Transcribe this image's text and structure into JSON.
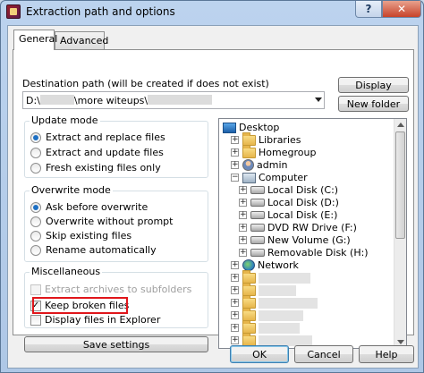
{
  "window": {
    "title": "Extraction path and options",
    "help_label": "?",
    "close_label": "✕"
  },
  "tabs": [
    {
      "label": "General",
      "active": true
    },
    {
      "label": "Advanced",
      "active": false
    }
  ],
  "destination": {
    "label": "Destination path (will be created if does not exist)",
    "path_prefix": "D:\\",
    "path_middle": "\\more witeups\\"
  },
  "buttons": {
    "display": "Display",
    "new_folder": "New folder",
    "save_settings": "Save settings",
    "ok": "OK",
    "cancel": "Cancel",
    "help": "Help"
  },
  "update_mode": {
    "title": "Update mode",
    "options": [
      {
        "label": "Extract and replace files",
        "selected": true
      },
      {
        "label": "Extract and update files",
        "selected": false
      },
      {
        "label": "Fresh existing files only",
        "selected": false
      }
    ]
  },
  "overwrite_mode": {
    "title": "Overwrite mode",
    "options": [
      {
        "label": "Ask before overwrite",
        "selected": true
      },
      {
        "label": "Overwrite without prompt",
        "selected": false
      },
      {
        "label": "Skip existing files",
        "selected": false
      },
      {
        "label": "Rename automatically",
        "selected": false
      }
    ]
  },
  "miscellaneous": {
    "title": "Miscellaneous",
    "options": [
      {
        "label": "Extract archives to subfolders",
        "checked": false,
        "disabled": true
      },
      {
        "label": "Keep broken files",
        "checked": true,
        "disabled": false
      },
      {
        "label": "Display files in Explorer",
        "checked": false,
        "disabled": false
      }
    ]
  },
  "tree": {
    "items": [
      {
        "label": "Desktop",
        "icon": "desktop-icon",
        "level": 0,
        "expander": ""
      },
      {
        "label": "Libraries",
        "icon": "folder-icon",
        "level": 1,
        "expander": "+"
      },
      {
        "label": "Homegroup",
        "icon": "folder-icon",
        "level": 1,
        "expander": "+"
      },
      {
        "label": "admin",
        "icon": "user-icon",
        "level": 1,
        "expander": "+"
      },
      {
        "label": "Computer",
        "icon": "computer-icon",
        "level": 1,
        "expander": "−"
      },
      {
        "label": "Local Disk (C:)",
        "icon": "drive-icon",
        "level": 2,
        "expander": "+"
      },
      {
        "label": "Local Disk (D:)",
        "icon": "drive-icon",
        "level": 2,
        "expander": "+"
      },
      {
        "label": "Local Disk (E:)",
        "icon": "drive-icon",
        "level": 2,
        "expander": "+"
      },
      {
        "label": "DVD RW Drive (F:)",
        "icon": "drive-icon",
        "level": 2,
        "expander": "+"
      },
      {
        "label": "New Volume (G:)",
        "icon": "drive-icon",
        "level": 2,
        "expander": "+"
      },
      {
        "label": "Removable Disk (H:)",
        "icon": "drive-icon",
        "level": 2,
        "expander": "+"
      },
      {
        "label": "Network",
        "icon": "globe-icon",
        "level": 1,
        "expander": "+"
      },
      {
        "label": "",
        "icon": "folder-icon",
        "level": 1,
        "expander": "+"
      },
      {
        "label": "",
        "icon": "folder-icon",
        "level": 1,
        "expander": "+"
      },
      {
        "label": "",
        "icon": "folder-icon",
        "level": 1,
        "expander": "+"
      },
      {
        "label": "",
        "icon": "folder-icon",
        "level": 1,
        "expander": "+"
      },
      {
        "label": "",
        "icon": "folder-icon",
        "level": 1,
        "expander": "+"
      },
      {
        "label": "",
        "icon": "folder-icon",
        "level": 1,
        "expander": "+"
      },
      {
        "label": "",
        "icon": "folder-icon",
        "level": 1,
        "expander": "+"
      }
    ]
  },
  "colors": {
    "highlight_box": "#e0161b",
    "radio_dot": "#1e70c4",
    "title_bar": "#bcd3ee"
  }
}
